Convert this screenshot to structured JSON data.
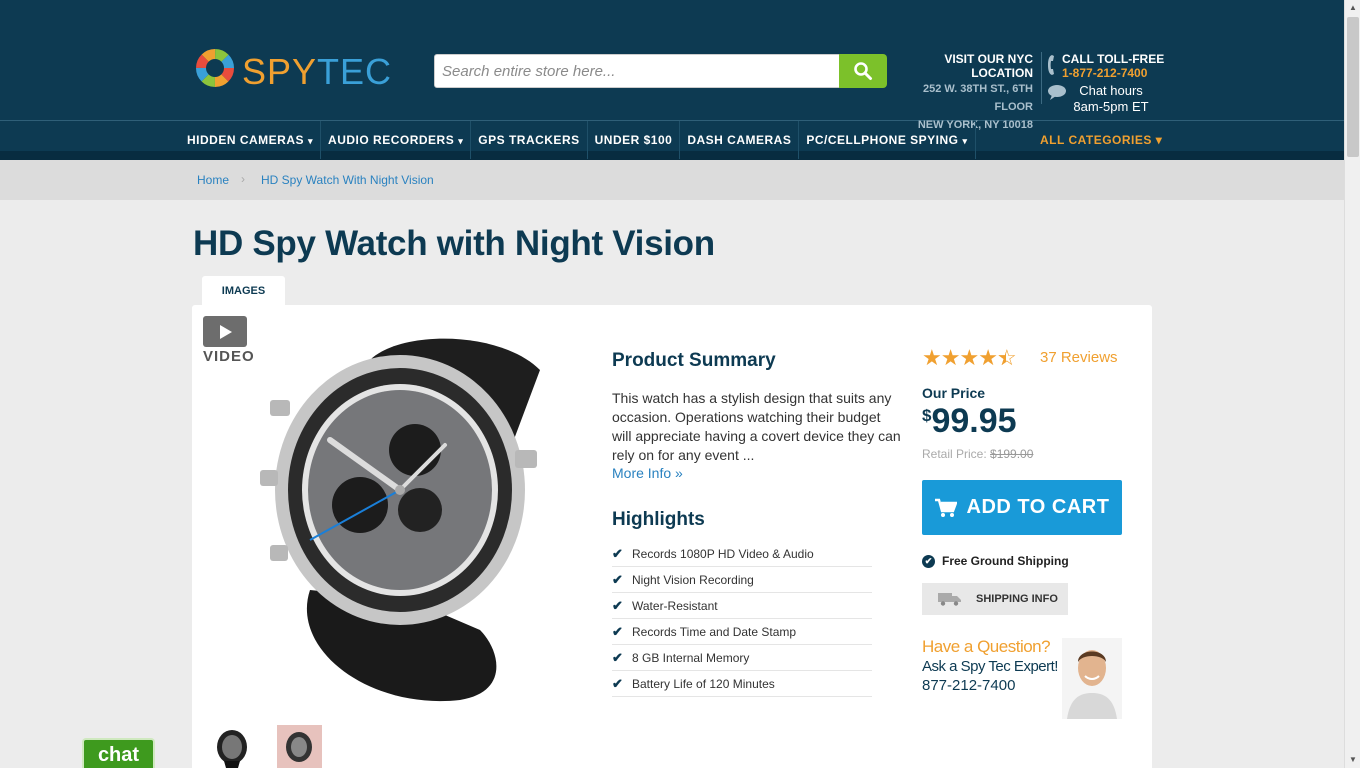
{
  "header": {
    "logo_text_a": "SPY",
    "logo_text_b": "TEC",
    "search_placeholder": "Search entire store here...",
    "nyc_title": "VISIT OUR NYC LOCATION",
    "nyc_address1": "252 W. 38TH ST., 6TH FLOOR",
    "nyc_address2": "NEW YORK, NY 10018",
    "toll_title": "CALL TOLL-FREE",
    "toll_phone": "1-877-212-7400",
    "chat_hours1": "Chat hours",
    "chat_hours2": "8am-5pm ET"
  },
  "nav": {
    "items": [
      {
        "label": "HIDDEN CAMERAS",
        "caret": "▾"
      },
      {
        "label": "AUDIO RECORDERS",
        "caret": "▾"
      },
      {
        "label": "GPS TRACKERS",
        "caret": ""
      },
      {
        "label": "UNDER $100",
        "caret": ""
      },
      {
        "label": "DASH CAMERAS",
        "caret": ""
      },
      {
        "label": "PC/CELLPHONE SPYING",
        "caret": "▾"
      }
    ],
    "all_categories": "ALL CATEGORIES ▾"
  },
  "breadcrumb": {
    "home": "Home",
    "separator": "›",
    "current": "HD Spy Watch With Night Vision"
  },
  "product": {
    "title": "HD Spy Watch with Night Vision",
    "tab_images": "IMAGES",
    "video_label": "VIDEO",
    "summary_heading": "Product Summary",
    "summary_text": "This watch has a stylish design that suits any occasion.  Operations watching their budget will appreciate having a covert device they can rely on for any event ...",
    "more_info": "More Info »",
    "highlights_heading": "Highlights",
    "highlights": [
      "Records 1080P HD Video & Audio",
      "Night Vision Recording",
      "Water-Resistant",
      "Records Time and Date Stamp",
      "8 GB Internal Memory",
      "Battery Life of 120 Minutes"
    ],
    "rating": 4.5,
    "reviews": "37 Reviews",
    "our_price_label": "Our Price",
    "currency": "$",
    "price": "99.95",
    "retail_label": "Retail Price:",
    "retail_price": "$199.00",
    "add_to_cart": "ADD TO CART",
    "free_shipping": "Free Ground Shipping",
    "shipping_info": "SHIPPING INFO",
    "question1": "Have a Question?",
    "question2": "Ask a Spy Tec Expert!",
    "question3": "877-212-7400"
  },
  "chat_button": "chat",
  "colors": {
    "header_bg": "#0d3a52",
    "accent_orange": "#f0a030",
    "search_green": "#7cc12a",
    "cart_blue": "#199ad8",
    "chat_green": "#3e9a1e"
  }
}
